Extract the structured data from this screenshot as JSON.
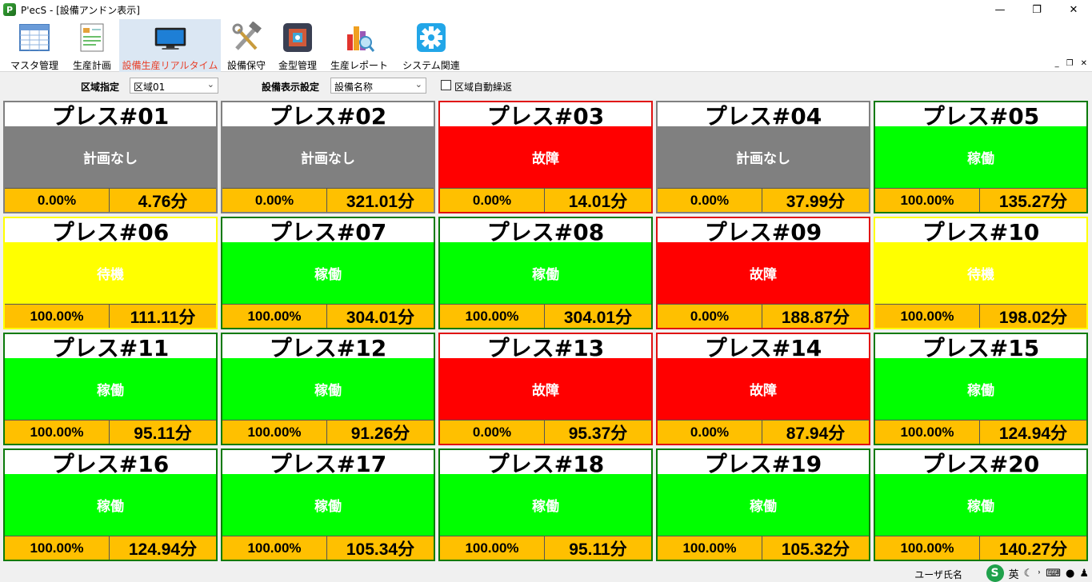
{
  "window": {
    "title": "P'ecS - [設備アンドン表示]",
    "controls": [
      "—",
      "❐",
      "✕"
    ]
  },
  "toolbar": {
    "items": [
      {
        "label": "マスタ管理",
        "icon": "table-icon"
      },
      {
        "label": "生産計画",
        "icon": "plan-sheet-icon"
      },
      {
        "label": "設備生産リアルタイム",
        "icon": "monitor-icon"
      },
      {
        "label": "設備保守",
        "icon": "tools-icon"
      },
      {
        "label": "金型管理",
        "icon": "mold-icon"
      },
      {
        "label": "生産レポート",
        "icon": "report-chart-icon"
      },
      {
        "label": "システム関連",
        "icon": "gear-icon"
      }
    ],
    "mdi_controls": [
      "_",
      "❐",
      "✕"
    ]
  },
  "filters": {
    "area_label": "区域指定",
    "area_value": "区域01",
    "display_label": "設備表示設定",
    "display_value": "設備名称",
    "auto_repeat_label": "区域自動繰返"
  },
  "colors": {
    "running": "#00ff00",
    "fault": "#ff0000",
    "no_plan": "#808080",
    "standby": "#ffff00",
    "metric_bg": "#ffc000"
  },
  "tiles": [
    {
      "name": "プレス#01",
      "status": "計画なし",
      "state": "no_plan",
      "rate": "0.00%",
      "time": "4.76分"
    },
    {
      "name": "プレス#02",
      "status": "計画なし",
      "state": "no_plan",
      "rate": "0.00%",
      "time": "321.01分"
    },
    {
      "name": "プレス#03",
      "status": "故障",
      "state": "fault",
      "rate": "0.00%",
      "time": "14.01分"
    },
    {
      "name": "プレス#04",
      "status": "計画なし",
      "state": "no_plan",
      "rate": "0.00%",
      "time": "37.99分"
    },
    {
      "name": "プレス#05",
      "status": "稼働",
      "state": "running",
      "rate": "100.00%",
      "time": "135.27分"
    },
    {
      "name": "プレス#06",
      "status": "待機",
      "state": "standby",
      "rate": "100.00%",
      "time": "111.11分"
    },
    {
      "name": "プレス#07",
      "status": "稼働",
      "state": "running",
      "rate": "100.00%",
      "time": "304.01分"
    },
    {
      "name": "プレス#08",
      "status": "稼働",
      "state": "running",
      "rate": "100.00%",
      "time": "304.01分"
    },
    {
      "name": "プレス#09",
      "status": "故障",
      "state": "fault",
      "rate": "0.00%",
      "time": "188.87分"
    },
    {
      "name": "プレス#10",
      "status": "待機",
      "state": "standby",
      "rate": "100.00%",
      "time": "198.02分"
    },
    {
      "name": "プレス#11",
      "status": "稼働",
      "state": "running",
      "rate": "100.00%",
      "time": "95.11分"
    },
    {
      "name": "プレス#12",
      "status": "稼働",
      "state": "running",
      "rate": "100.00%",
      "time": "91.26分"
    },
    {
      "name": "プレス#13",
      "status": "故障",
      "state": "fault",
      "rate": "0.00%",
      "time": "95.37分"
    },
    {
      "name": "プレス#14",
      "status": "故障",
      "state": "fault",
      "rate": "0.00%",
      "time": "87.94分"
    },
    {
      "name": "プレス#15",
      "status": "稼働",
      "state": "running",
      "rate": "100.00%",
      "time": "124.94分"
    },
    {
      "name": "プレス#16",
      "status": "稼働",
      "state": "running",
      "rate": "100.00%",
      "time": "124.94分"
    },
    {
      "name": "プレス#17",
      "status": "稼働",
      "state": "running",
      "rate": "100.00%",
      "time": "105.34分"
    },
    {
      "name": "プレス#18",
      "status": "稼働",
      "state": "running",
      "rate": "100.00%",
      "time": "95.11分"
    },
    {
      "name": "プレス#19",
      "status": "稼働",
      "state": "running",
      "rate": "100.00%",
      "time": "105.32分"
    },
    {
      "name": "プレス#20",
      "status": "稼働",
      "state": "running",
      "rate": "100.00%",
      "time": "140.27分"
    }
  ],
  "statusbar": {
    "user_label": "ユーザ氏名",
    "ime_s": "S",
    "ime_lang": "英",
    "ime_icons": [
      "moon-icon",
      "comma-icon",
      "keyboard-icon",
      "user-icon",
      "shirt-icon"
    ]
  }
}
